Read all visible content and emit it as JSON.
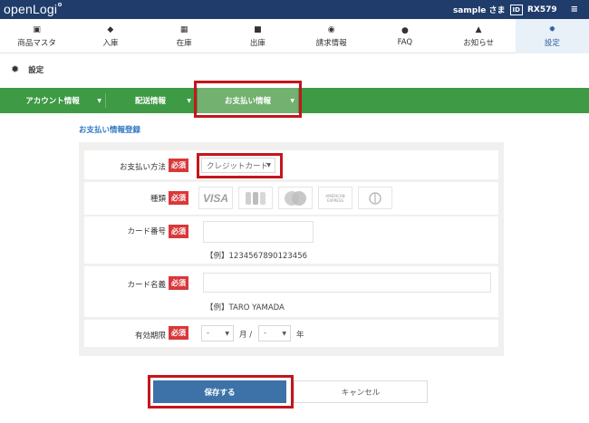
{
  "header": {
    "logo": "openLogi",
    "user": "sample さま",
    "id_badge": "ID",
    "account_code": "RX579"
  },
  "nav": [
    {
      "label": "商品マスタ",
      "icon": "product-icon"
    },
    {
      "label": "入庫",
      "icon": "inbound-icon"
    },
    {
      "label": "在庫",
      "icon": "inventory-icon"
    },
    {
      "label": "出庫",
      "icon": "truck-icon"
    },
    {
      "label": "請求情報",
      "icon": "billing-icon"
    },
    {
      "label": "FAQ",
      "icon": "question-icon"
    },
    {
      "label": "お知らせ",
      "icon": "bell-icon"
    },
    {
      "label": "設定",
      "icon": "gear-icon"
    }
  ],
  "active_nav": "設定",
  "page_title": "設定",
  "subnav": [
    {
      "label": "アカウント情報"
    },
    {
      "label": "配送情報"
    },
    {
      "label": "お支払い情報"
    }
  ],
  "active_subnav": "お支払い情報",
  "form": {
    "section_title": "お支払い情報登録",
    "required_label": "必須",
    "payment_method": {
      "label": "お支払い方法",
      "value": "クレジットカード"
    },
    "card_type": {
      "label": "種類",
      "brands": [
        "VISA",
        "JCB",
        "MasterCard",
        "AMERICAN EXPRESS",
        "Diners Club"
      ]
    },
    "card_number": {
      "label": "カード番号",
      "value": "",
      "hint": "【例】1234567890123456"
    },
    "card_name": {
      "label": "カード名義",
      "value": "",
      "hint": "【例】TARO YAMADA"
    },
    "expiry": {
      "label": "有効期限",
      "month_value": "-",
      "month_unit": "月 /",
      "year_value": "-",
      "year_unit": "年"
    }
  },
  "buttons": {
    "save": "保存する",
    "cancel": "キャンセル"
  },
  "colors": {
    "header": "#1f3c6b",
    "green": "#3e9a45",
    "active_tab": "#72b16f",
    "save": "#3d72a9",
    "required": "#d9383a",
    "highlight": "#c4161c"
  }
}
